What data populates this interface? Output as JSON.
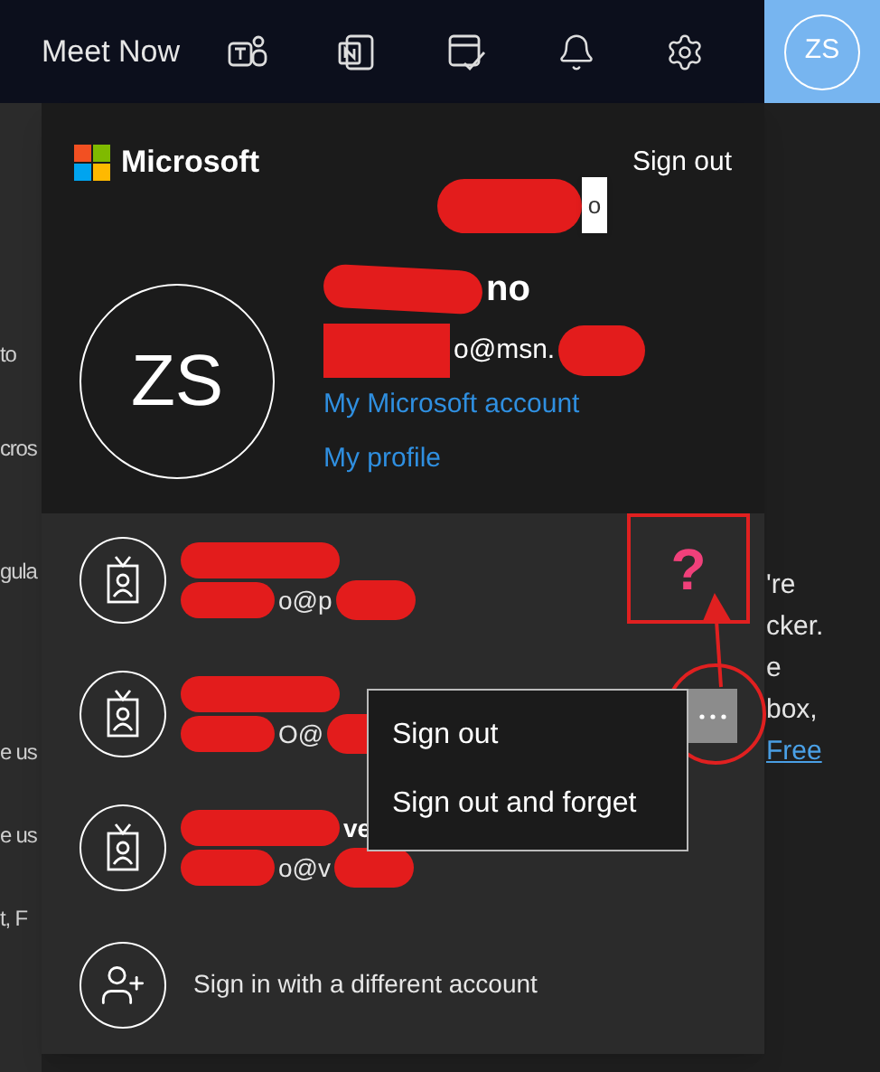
{
  "topbar": {
    "title": "Meet Now",
    "avatar_initials": "ZS"
  },
  "background": {
    "left_fragments": [
      "to",
      "cros",
      "gula",
      "e us",
      "e us",
      "t, F"
    ],
    "right_fragments": [
      "'re",
      "cker.",
      "e",
      "box,"
    ],
    "right_link": "Free"
  },
  "panel": {
    "brand": "Microsoft",
    "sign_out": "Sign out",
    "tag_fragment": "o",
    "avatar_initials": "ZS",
    "name_fragment": "no",
    "email_fragment": "o@msn.",
    "links": [
      "My Microsoft account",
      "My profile"
    ]
  },
  "accounts": [
    {
      "email_fragment": "o@p",
      "menu_open": false
    },
    {
      "email_fragment": "O@",
      "menu_open": true
    },
    {
      "name_fragment": "ve",
      "email_fragment": "o@v",
      "menu_open": false
    }
  ],
  "context_menu": [
    "Sign out",
    "Sign out and forget"
  ],
  "add_account": "Sign in with a different account",
  "annotation_mark": "?"
}
